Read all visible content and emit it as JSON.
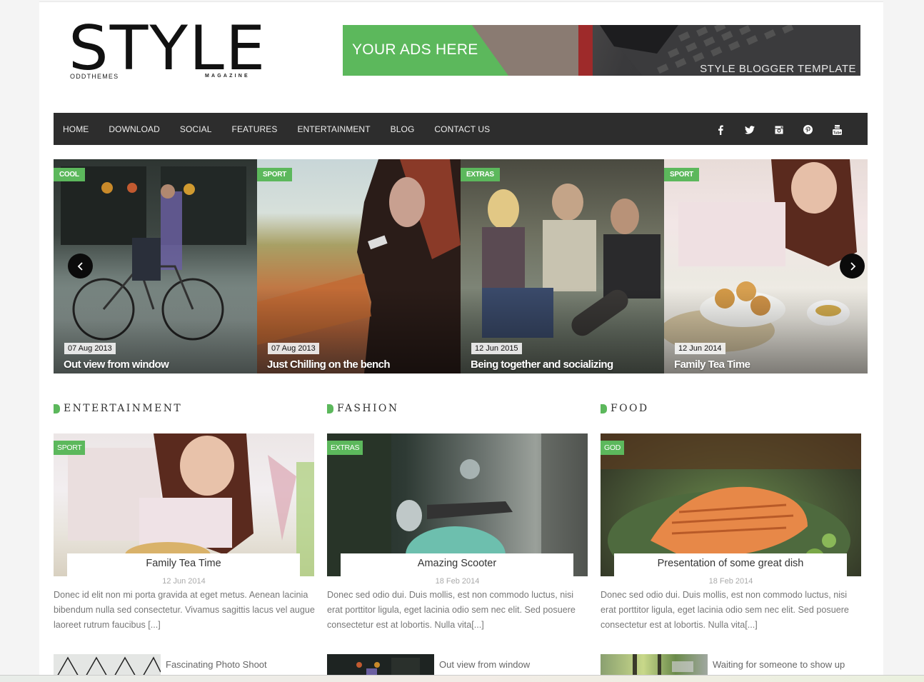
{
  "header": {
    "logo": {
      "main": "STYLE",
      "left_sub": "ODDTHEMES",
      "right_sub": "MAGAZINE"
    },
    "ad": {
      "headline": "YOUR ADS HERE",
      "subtext": "STYLE BLOGGER TEMPLATE",
      "accent": "#5cb85c"
    }
  },
  "nav": {
    "items": [
      "HOME",
      "DOWNLOAD",
      "SOCIAL",
      "FEATURES",
      "ENTERTAINMENT",
      "BLOG",
      "CONTACT US"
    ],
    "social": [
      {
        "name": "facebook",
        "glyph": "f"
      },
      {
        "name": "twitter",
        "glyph": "twitter"
      },
      {
        "name": "instagram",
        "glyph": "instagram"
      },
      {
        "name": "pinterest",
        "glyph": "pinterest"
      },
      {
        "name": "youtube",
        "glyph": "youtube"
      }
    ]
  },
  "slider": {
    "slides": [
      {
        "tag": "COOL",
        "date": "07 Aug 2013",
        "title": "Out view from window"
      },
      {
        "tag": "SPORT",
        "date": "07 Aug 2013",
        "title": "Just Chilling on the bench"
      },
      {
        "tag": "EXTRAS",
        "date": "12 Jun 2015",
        "title": "Being together and socializing"
      },
      {
        "tag": "SPORT",
        "date": "12 Jun 2014",
        "title": "Family Tea Time"
      }
    ],
    "prev_icon": "chevron-left",
    "next_icon": "chevron-right"
  },
  "sections": [
    {
      "title": "ENTERTAINMENT",
      "featured": {
        "tag": "SPORT",
        "title": "Family Tea Time",
        "date": "12 Jun 2014",
        "excerpt": "Donec id elit non mi porta gravida at eget metus. Aenean lacinia bibendum nulla sed consectetur. Vivamus sagittis lacus vel augue laoreet rutrum faucibus [...]"
      },
      "list": [
        {
          "title": "Fascinating Photo Shoot"
        }
      ]
    },
    {
      "title": "FASHION",
      "featured": {
        "tag": "EXTRAS",
        "title": "Amazing Scooter",
        "date": "18 Feb 2014",
        "excerpt": "Donec sed odio dui. Duis mollis, est non commodo luctus, nisi erat porttitor ligula, eget lacinia odio sem nec elit. Sed posuere consectetur est at lobortis. Nulla vita[...]"
      },
      "list": [
        {
          "title": "Out view from window"
        }
      ]
    },
    {
      "title": "FOOD",
      "featured": {
        "tag": "GOD",
        "title": "Presentation of some great dish",
        "date": "18 Feb 2014",
        "excerpt": "Donec sed odio dui. Duis mollis, est non commodo luctus, nisi erat porttitor ligula, eget lacinia odio sem nec elit. Sed posuere consectetur est at lobortis. Nulla vita[...]"
      },
      "list": [
        {
          "title": "Waiting for someone to show up"
        }
      ]
    }
  ]
}
